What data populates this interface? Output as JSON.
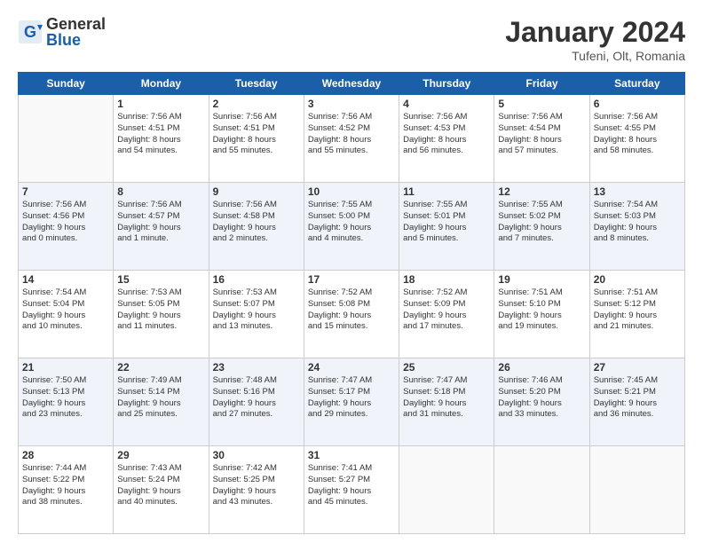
{
  "header": {
    "logo_general": "General",
    "logo_blue": "Blue",
    "month_title": "January 2024",
    "location": "Tufeni, Olt, Romania"
  },
  "weekdays": [
    "Sunday",
    "Monday",
    "Tuesday",
    "Wednesday",
    "Thursday",
    "Friday",
    "Saturday"
  ],
  "weeks": [
    [
      {
        "day": "",
        "info": ""
      },
      {
        "day": "1",
        "info": "Sunrise: 7:56 AM\nSunset: 4:51 PM\nDaylight: 8 hours\nand 54 minutes."
      },
      {
        "day": "2",
        "info": "Sunrise: 7:56 AM\nSunset: 4:51 PM\nDaylight: 8 hours\nand 55 minutes."
      },
      {
        "day": "3",
        "info": "Sunrise: 7:56 AM\nSunset: 4:52 PM\nDaylight: 8 hours\nand 55 minutes."
      },
      {
        "day": "4",
        "info": "Sunrise: 7:56 AM\nSunset: 4:53 PM\nDaylight: 8 hours\nand 56 minutes."
      },
      {
        "day": "5",
        "info": "Sunrise: 7:56 AM\nSunset: 4:54 PM\nDaylight: 8 hours\nand 57 minutes."
      },
      {
        "day": "6",
        "info": "Sunrise: 7:56 AM\nSunset: 4:55 PM\nDaylight: 8 hours\nand 58 minutes."
      }
    ],
    [
      {
        "day": "7",
        "info": "Sunrise: 7:56 AM\nSunset: 4:56 PM\nDaylight: 9 hours\nand 0 minutes."
      },
      {
        "day": "8",
        "info": "Sunrise: 7:56 AM\nSunset: 4:57 PM\nDaylight: 9 hours\nand 1 minute."
      },
      {
        "day": "9",
        "info": "Sunrise: 7:56 AM\nSunset: 4:58 PM\nDaylight: 9 hours\nand 2 minutes."
      },
      {
        "day": "10",
        "info": "Sunrise: 7:55 AM\nSunset: 5:00 PM\nDaylight: 9 hours\nand 4 minutes."
      },
      {
        "day": "11",
        "info": "Sunrise: 7:55 AM\nSunset: 5:01 PM\nDaylight: 9 hours\nand 5 minutes."
      },
      {
        "day": "12",
        "info": "Sunrise: 7:55 AM\nSunset: 5:02 PM\nDaylight: 9 hours\nand 7 minutes."
      },
      {
        "day": "13",
        "info": "Sunrise: 7:54 AM\nSunset: 5:03 PM\nDaylight: 9 hours\nand 8 minutes."
      }
    ],
    [
      {
        "day": "14",
        "info": "Sunrise: 7:54 AM\nSunset: 5:04 PM\nDaylight: 9 hours\nand 10 minutes."
      },
      {
        "day": "15",
        "info": "Sunrise: 7:53 AM\nSunset: 5:05 PM\nDaylight: 9 hours\nand 11 minutes."
      },
      {
        "day": "16",
        "info": "Sunrise: 7:53 AM\nSunset: 5:07 PM\nDaylight: 9 hours\nand 13 minutes."
      },
      {
        "day": "17",
        "info": "Sunrise: 7:52 AM\nSunset: 5:08 PM\nDaylight: 9 hours\nand 15 minutes."
      },
      {
        "day": "18",
        "info": "Sunrise: 7:52 AM\nSunset: 5:09 PM\nDaylight: 9 hours\nand 17 minutes."
      },
      {
        "day": "19",
        "info": "Sunrise: 7:51 AM\nSunset: 5:10 PM\nDaylight: 9 hours\nand 19 minutes."
      },
      {
        "day": "20",
        "info": "Sunrise: 7:51 AM\nSunset: 5:12 PM\nDaylight: 9 hours\nand 21 minutes."
      }
    ],
    [
      {
        "day": "21",
        "info": "Sunrise: 7:50 AM\nSunset: 5:13 PM\nDaylight: 9 hours\nand 23 minutes."
      },
      {
        "day": "22",
        "info": "Sunrise: 7:49 AM\nSunset: 5:14 PM\nDaylight: 9 hours\nand 25 minutes."
      },
      {
        "day": "23",
        "info": "Sunrise: 7:48 AM\nSunset: 5:16 PM\nDaylight: 9 hours\nand 27 minutes."
      },
      {
        "day": "24",
        "info": "Sunrise: 7:47 AM\nSunset: 5:17 PM\nDaylight: 9 hours\nand 29 minutes."
      },
      {
        "day": "25",
        "info": "Sunrise: 7:47 AM\nSunset: 5:18 PM\nDaylight: 9 hours\nand 31 minutes."
      },
      {
        "day": "26",
        "info": "Sunrise: 7:46 AM\nSunset: 5:20 PM\nDaylight: 9 hours\nand 33 minutes."
      },
      {
        "day": "27",
        "info": "Sunrise: 7:45 AM\nSunset: 5:21 PM\nDaylight: 9 hours\nand 36 minutes."
      }
    ],
    [
      {
        "day": "28",
        "info": "Sunrise: 7:44 AM\nSunset: 5:22 PM\nDaylight: 9 hours\nand 38 minutes."
      },
      {
        "day": "29",
        "info": "Sunrise: 7:43 AM\nSunset: 5:24 PM\nDaylight: 9 hours\nand 40 minutes."
      },
      {
        "day": "30",
        "info": "Sunrise: 7:42 AM\nSunset: 5:25 PM\nDaylight: 9 hours\nand 43 minutes."
      },
      {
        "day": "31",
        "info": "Sunrise: 7:41 AM\nSunset: 5:27 PM\nDaylight: 9 hours\nand 45 minutes."
      },
      {
        "day": "",
        "info": ""
      },
      {
        "day": "",
        "info": ""
      },
      {
        "day": "",
        "info": ""
      }
    ]
  ]
}
